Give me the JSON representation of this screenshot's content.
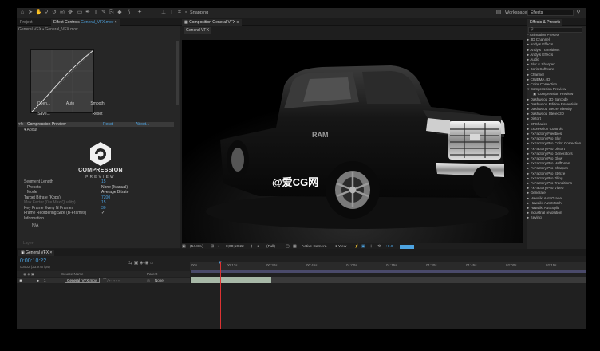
{
  "toolbar": {
    "snapping_label": "Snapping",
    "workspace_label": "Workspace:",
    "workspace_value": "Effects",
    "tool_icons": [
      "home-icon",
      "selection-arrow-icon",
      "hand-icon",
      "zoom-icon",
      "rotate-icon",
      "camera-orbit-icon",
      "pan-behind-icon",
      "rectangle-icon",
      "pen-icon",
      "text-icon",
      "brush-icon",
      "clone-stamp-icon",
      "eraser-icon",
      "roto-brush-icon",
      "puppet-pin-icon"
    ]
  },
  "left_panel": {
    "tabs": [
      "Project",
      "Effect Controls",
      "General_VFX.mov"
    ],
    "breadcrumb": "General VFX • General_VFX.mov",
    "buttons": {
      "open": "Open...",
      "auto": "Auto",
      "smooth": "Smooth",
      "save": "Save...",
      "reset": "Reset"
    },
    "effect": {
      "name": "Compression Preview",
      "reset": "Reset",
      "about": "About..."
    },
    "about_label": "About",
    "brand_name": "COMPRESSION",
    "brand_sub": "PREVIEW",
    "params": [
      {
        "label": "Segment Length",
        "value": "15"
      },
      {
        "label": "Presets",
        "value": "None (Manual)"
      },
      {
        "label": "Mode",
        "value": "Average Bitrate"
      },
      {
        "label": "Target Bitrate (Kbps)",
        "value": "7200"
      },
      {
        "label": "Max Factor (0 = Max Quality)",
        "value": "15"
      },
      {
        "label": "Key Frame Every N Frames",
        "value": "30"
      },
      {
        "label": "Frame Reordering Size (B-Frames)",
        "value": "✓"
      },
      {
        "label": "Information",
        "value": ""
      },
      {
        "label": "N/A",
        "value": ""
      }
    ],
    "footer": "Layer"
  },
  "composition": {
    "tab_label": "Composition General VFX",
    "subtab": "General VFX",
    "watermark": "@爱CG网",
    "bar": {
      "zoom": "(54.8%)",
      "time": "0;00;10;22",
      "resolution": "(Full)",
      "camera": "Active Camera",
      "views": "1 View",
      "exposure": "+0.0"
    }
  },
  "effects_panel": {
    "title": "Effects & Presets",
    "items": [
      "* Animation Presets",
      "3D Channel",
      "Andy's Effects",
      "Andy's Transitions",
      "Andy's Effects",
      "Audio",
      "Blur & Sharpen",
      "Boris Software",
      "Channel",
      "CINEMA 4D",
      "Color Correction",
      "Compression Preview",
      "Compression Preview",
      "Dashwood 3D Barcode",
      "Dashwood Edition Essentials",
      "Dashwood Secret Identity",
      "Dashwood Stereo3D",
      "Distort",
      "DFShader",
      "Expression Controls",
      "FxFactory Freebies",
      "FxFactory Pro Blur",
      "FxFactory Pro Color Correction",
      "FxFactory Pro Distort",
      "FxFactory Pro Generators",
      "FxFactory Pro Glow",
      "FxFactory Pro Halftones",
      "FxFactory Pro Sharpen",
      "FxFactory Pro Stylize",
      "FxFactory Pro Tiling",
      "FxFactory Pro Transitions",
      "FxFactory Pro Video",
      "Generate",
      "Hawaiki AutoGrade",
      "Hawaiki AutoMatch",
      "Hawaiki AutoSplit",
      "Industrial revolution",
      "Keying"
    ]
  },
  "timeline": {
    "tab": "General VFX",
    "timecode": "0:00:10:22",
    "fps": "00502 (23.976 fps)",
    "columns": {
      "source": "Source Name",
      "parent": "Parent"
    },
    "layer": {
      "index": "1",
      "name": "General_VFX.mov",
      "parent": "None"
    },
    "ruler": [
      "00s",
      "00:12s",
      "00:30s",
      "00:45s",
      "01:00s",
      "01:15s",
      "01:30s",
      "01:45s",
      "02:00s",
      "02:15s"
    ]
  }
}
